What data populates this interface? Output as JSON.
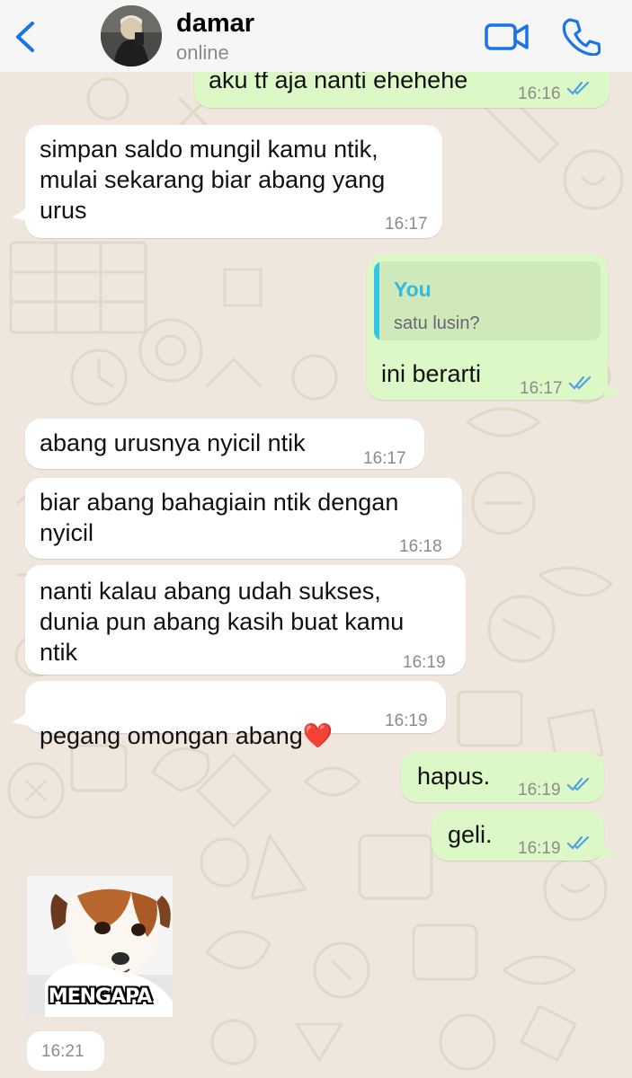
{
  "header": {
    "contact_name": "damar",
    "status": "online",
    "icons": [
      "chevron-left-icon",
      "avatar",
      "video-call-icon",
      "voice-call-icon"
    ],
    "accent_color": "#1a73e8"
  },
  "messages": [
    {
      "direction": "out",
      "text": "aku tf aja nanti ehehehe",
      "time": "16:16",
      "read": true
    },
    {
      "direction": "in",
      "text": "simpan saldo mungil kamu ntik,\nmulai sekarang biar abang yang\nurus",
      "time": "16:17"
    },
    {
      "direction": "out",
      "quote_author": "You",
      "quote_text": "satu lusin?",
      "text": "ini berarti",
      "time": "16:17",
      "read": true
    },
    {
      "direction": "in",
      "text": "abang urusnya nyicil ntik",
      "time": "16:17"
    },
    {
      "direction": "in",
      "text": "biar abang bahagiain ntik dengan\nnyicil",
      "time": "16:18"
    },
    {
      "direction": "in",
      "text": "nanti kalau abang udah sukses,\ndunia pun abang kasih buat kamu\nntik",
      "time": "16:19"
    },
    {
      "direction": "in",
      "text": "pegang omongan abang",
      "emoji": "❤️",
      "time": "16:19"
    },
    {
      "direction": "out",
      "text": "hapus.",
      "time": "16:19",
      "read": true
    },
    {
      "direction": "out",
      "text": "geli.",
      "time": "16:19",
      "read": true
    },
    {
      "direction": "in",
      "type": "sticker",
      "caption": "MENGAPA",
      "time": "16:21"
    }
  ],
  "colors": {
    "incoming_bubble": "#ffffff",
    "outgoing_bubble": "#dcf8c6",
    "read_ticks": "#4fa3e0",
    "quote_author": "#35b9dc"
  }
}
